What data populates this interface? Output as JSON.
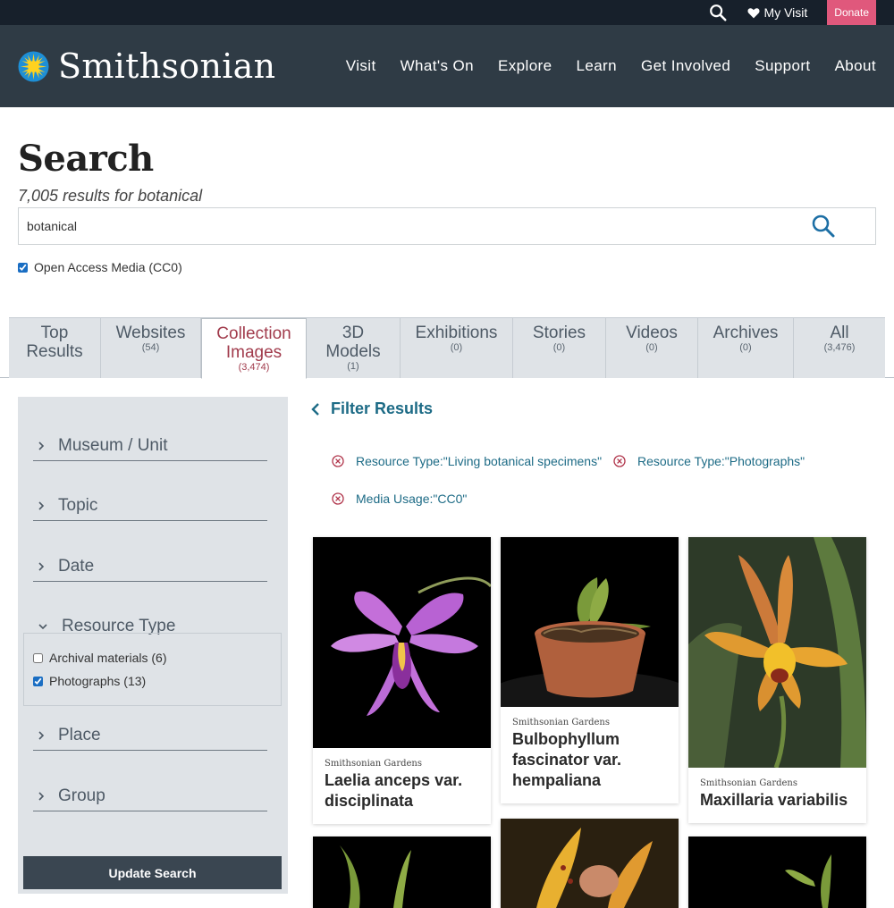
{
  "utility": {
    "my_visit": "My Visit",
    "donate": "Donate"
  },
  "header": {
    "logo_text": "Smithsonian",
    "nav": [
      "Visit",
      "What's On",
      "Explore",
      "Learn",
      "Get Involved",
      "Support",
      "About"
    ]
  },
  "search": {
    "title": "Search",
    "result_count": "7,005 results for botanical",
    "query": "botanical",
    "open_access_label": "Open Access Media (CC0)",
    "open_access_checked": true
  },
  "tabs": [
    {
      "label1": "Top",
      "label2": "Results",
      "count": ""
    },
    {
      "label1": "Websites",
      "label2": "",
      "count": "(54)"
    },
    {
      "label1": "Collection",
      "label2": "Images",
      "count": "(3,474)"
    },
    {
      "label1": "3D",
      "label2": "Models",
      "count": "(1)"
    },
    {
      "label1": "Exhibitions",
      "label2": "",
      "count": "(0)"
    },
    {
      "label1": "Stories",
      "label2": "",
      "count": "(0)"
    },
    {
      "label1": "Videos",
      "label2": "",
      "count": "(0)"
    },
    {
      "label1": "Archives",
      "label2": "",
      "count": "(0)"
    },
    {
      "label1": "All",
      "label2": "",
      "count": "(3,476)"
    }
  ],
  "sidebar": {
    "facets": [
      "Museum / Unit",
      "Topic",
      "Date",
      "Resource Type",
      "Place",
      "Group"
    ],
    "resource_type_options": [
      {
        "label": "Archival materials (6)",
        "checked": false
      },
      {
        "label": "Photographs (13)",
        "checked": true
      }
    ],
    "update_button": "Update Search"
  },
  "filters": {
    "heading": "Filter Results",
    "chips": [
      "Resource Type:\"Living botanical specimens\"",
      "Resource Type:\"Photographs\"",
      "Media Usage:\"CC0\""
    ]
  },
  "results": [
    {
      "unit": "Smithsonian Gardens",
      "title": "Laelia anceps var. disciplinata"
    },
    {
      "unit": "Smithsonian Gardens",
      "title": "Bulbophyllum fascinator var. hempaliana"
    },
    {
      "unit": "Smithsonian Gardens",
      "title": "Maxillaria variabilis"
    }
  ],
  "colors": {
    "utility_bg": "#17202b",
    "header_bg": "#2f3b45",
    "donate": "#e0587c",
    "active_tab": "#a13b4c",
    "link": "#1d6b86",
    "chip_icon": "#b0344a",
    "sidebar_bg": "#dfe3e7"
  }
}
